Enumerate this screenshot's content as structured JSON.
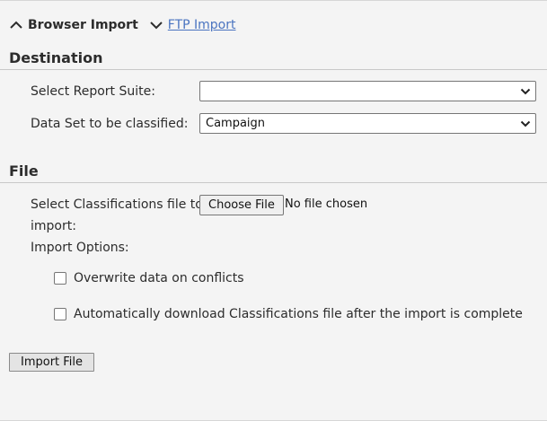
{
  "tabs": {
    "browser_import": "Browser Import",
    "ftp_import": "FTP Import"
  },
  "destination": {
    "title": "Destination",
    "report_suite_label": "Select Report Suite:",
    "report_suite_value": "",
    "data_set_label": "Data Set to be classified:",
    "data_set_value": "Campaign"
  },
  "file": {
    "title": "File",
    "select_file_label_line1": "Select Classifications file to",
    "select_file_label_line2": "import:",
    "choose_file_label": "Choose File",
    "file_status": "No file chosen",
    "import_options_label": "Import Options:",
    "overwrite_label": "Overwrite data on conflicts",
    "overwrite_checked": false,
    "auto_download_label": "Automatically download Classifications file after the import is complete",
    "auto_download_checked": false
  },
  "actions": {
    "import_file_label": "Import File"
  },
  "colors": {
    "link": "#4a74c0",
    "background": "#f4f4f4",
    "text": "#2c2c2c"
  },
  "icons": {
    "tab_expanded": "chevron-up-icon",
    "tab_collapsed": "chevron-down-icon",
    "select_caret": "chevron-down-icon"
  }
}
